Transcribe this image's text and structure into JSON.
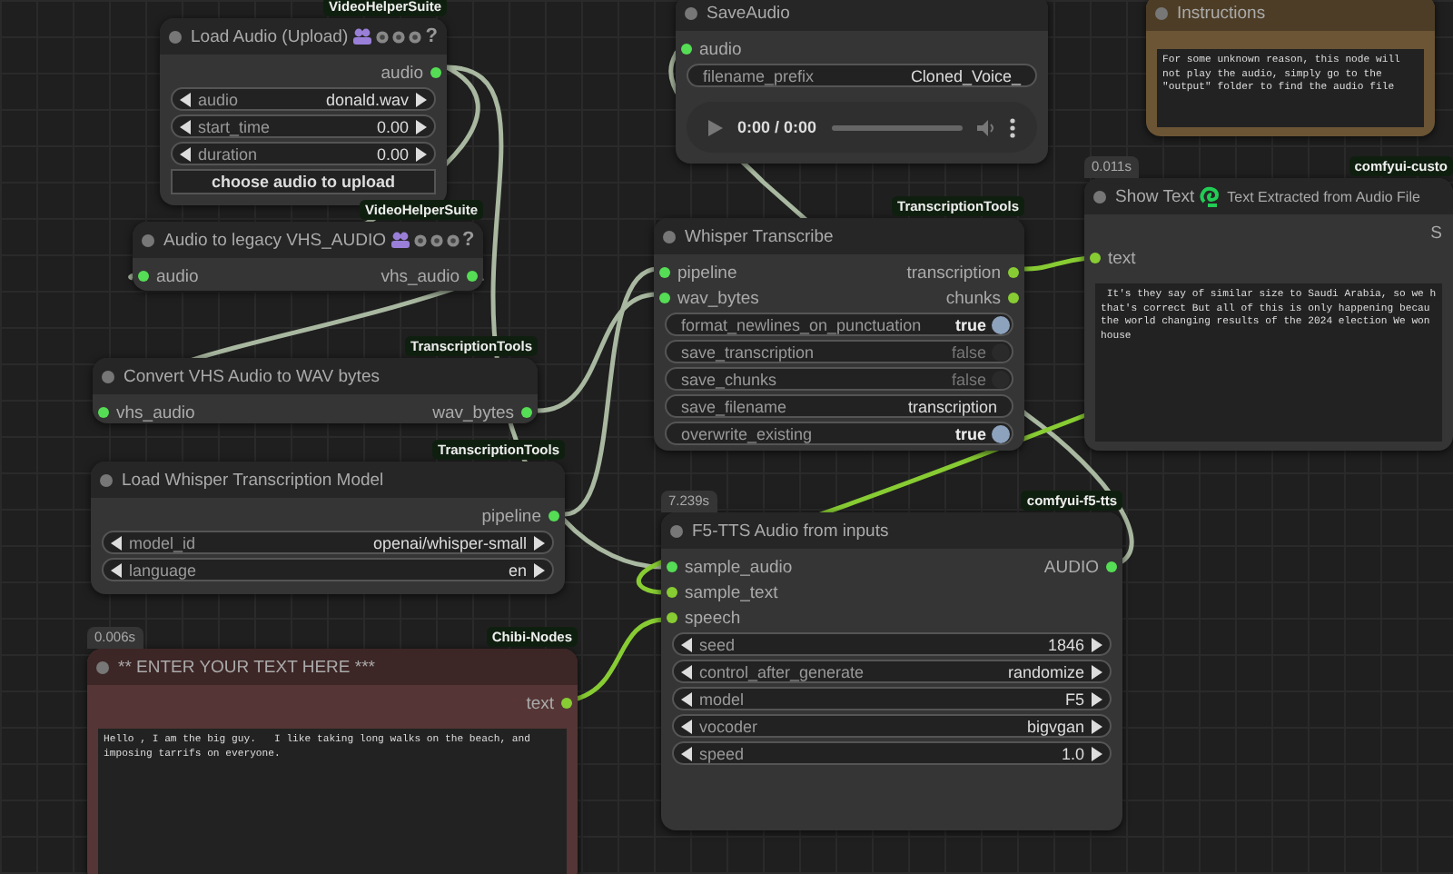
{
  "nodes": [
    {
      "title": "Load Audio (Upload)",
      "badge": "VideoHelperSuite",
      "title_icons": [
        {
          "kind": "people"
        },
        {
          "kind": "circle"
        },
        {
          "kind": "circle"
        },
        {
          "kind": "circle"
        }
      ],
      "help": "?",
      "color": "#353535",
      "outputs": [
        {
          "label": "audio",
          "color": "#55dd55"
        }
      ],
      "widgets": [
        {
          "kind": "combo",
          "label": "audio",
          "value": "donald.wav"
        },
        {
          "kind": "number",
          "label": "start_time",
          "value": "0.00"
        },
        {
          "kind": "number",
          "label": "duration",
          "value": "0.00"
        },
        {
          "kind": "button",
          "value": "choose audio to upload"
        }
      ]
    },
    {
      "title": "Audio to legacy VHS_AUDIO",
      "badge": "VideoHelperSuite",
      "title_icons": [
        {
          "kind": "people"
        },
        {
          "kind": "circle"
        },
        {
          "kind": "circle"
        },
        {
          "kind": "circle"
        }
      ],
      "help": "?",
      "color": "#353535",
      "inputs": [
        {
          "label": "audio",
          "color": "#55dd55"
        }
      ],
      "outputs": [
        {
          "label": "vhs_audio",
          "color": "#55dd55"
        }
      ]
    },
    {
      "title": "Convert VHS Audio to WAV bytes",
      "badge": "TranscriptionTools",
      "color": "#353535",
      "inputs": [
        {
          "label": "vhs_audio",
          "color": "#55dd55"
        }
      ],
      "outputs": [
        {
          "label": "wav_bytes",
          "color": "#55dd55"
        }
      ]
    },
    {
      "title": "Load Whisper Transcription Model",
      "badge": "TranscriptionTools",
      "color": "#353535",
      "outputs": [
        {
          "label": "pipeline",
          "color": "#55dd55"
        }
      ],
      "widgets": [
        {
          "kind": "combo",
          "label": "model_id",
          "value": "openai/whisper-small"
        },
        {
          "kind": "combo",
          "label": "language",
          "value": "en"
        }
      ]
    },
    {
      "title": "** ENTER YOUR TEXT HERE ***",
      "badge": "Chibi-Nodes",
      "timing": "0.006s",
      "color": "#553535",
      "outputs": [
        {
          "label": "text",
          "color": "#88cc33"
        }
      ],
      "widgets": [
        {
          "kind": "textarea",
          "value": "Hello , I am the big guy.   I like taking long walks on the beach, and\nimposing tarrifs on everyone."
        }
      ]
    },
    {
      "title": "SaveAudio",
      "color": "#353535",
      "inputs": [
        {
          "label": "audio",
          "color": "#55dd55"
        }
      ],
      "widgets": [
        {
          "kind": "text",
          "label": "filename_prefix",
          "value": "Cloned_Voice_"
        },
        {
          "kind": "audio_player",
          "value": "0:00 / 0:00"
        }
      ]
    },
    {
      "title": "Instructions",
      "color": "#6b5535",
      "widgets": [
        {
          "kind": "textarea",
          "value": "For some unknown reason, this node will\nnot play the audio, simply go to the\n\"output\" folder to find the audio file"
        }
      ]
    },
    {
      "title": "Whisper Transcribe",
      "badge": "TranscriptionTools",
      "color": "#353535",
      "inputs": [
        {
          "label": "pipeline",
          "color": "#55dd55"
        },
        {
          "label": "wav_bytes",
          "color": "#55dd55"
        }
      ],
      "outputs": [
        {
          "label": "transcription",
          "color": "#88cc33"
        },
        {
          "label": "chunks",
          "color": "#88cc33"
        }
      ],
      "widgets": [
        {
          "kind": "toggle",
          "label": "format_newlines_on_punctuation",
          "value": "true",
          "on": true
        },
        {
          "kind": "toggle",
          "label": "save_transcription",
          "value": "false",
          "on": false
        },
        {
          "kind": "toggle",
          "label": "save_chunks",
          "value": "false",
          "on": false
        },
        {
          "kind": "text",
          "label": "save_filename",
          "value": "transcription"
        },
        {
          "kind": "toggle",
          "label": "overwrite_existing",
          "value": "true",
          "on": true
        }
      ]
    },
    {
      "title": "Show Text",
      "title_icons": [
        {
          "kind": "swirl"
        }
      ],
      "subtitle": "Text Extracted from Audio File",
      "badge": "comfyui-custo",
      "timing": "0.011s",
      "column_3": "S",
      "color": "#353535",
      "inputs": [
        {
          "label": "text",
          "color": "#88cc33"
        }
      ],
      "widgets": [
        {
          "kind": "textarea",
          "value": " It's they say of similar size to Saudi Arabia, so we h\nthat's correct But all of this is only happening becau\nthe world changing results of the 2024 election We won\nhouse"
        }
      ]
    },
    {
      "title": "F5-TTS Audio from inputs",
      "badge": "comfyui-f5-tts",
      "timing": "7.239s",
      "color": "#353535",
      "inputs": [
        {
          "label": "sample_audio",
          "color": "#55dd55"
        },
        {
          "label": "sample_text",
          "color": "#88cc33"
        },
        {
          "label": "speech",
          "color": "#88cc33"
        }
      ],
      "outputs": [
        {
          "label": "AUDIO",
          "color": "#55dd55"
        }
      ],
      "widgets": [
        {
          "kind": "number",
          "label": "seed",
          "value": "1846"
        },
        {
          "kind": "combo",
          "label": "control_after_generate",
          "value": "randomize"
        },
        {
          "kind": "combo",
          "label": "model",
          "value": "F5"
        },
        {
          "kind": "combo",
          "label": "vocoder",
          "value": "bigvgan"
        },
        {
          "kind": "number",
          "label": "speed",
          "value": "1.0"
        }
      ]
    }
  ]
}
